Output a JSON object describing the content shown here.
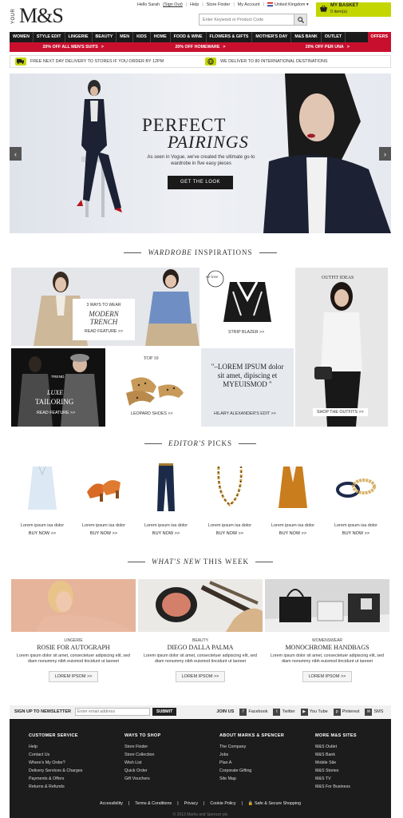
{
  "header": {
    "logo_your": "YOUR",
    "logo_text": "M&S",
    "greeting": "Hello Sarah",
    "sign_out": "(Sign Out)",
    "help": "Help",
    "store_finder": "Store Finder",
    "my_account": "My Account",
    "country": "United Kingdom",
    "search_placeholder": "Enter Keyword or Product Code",
    "basket_title": "MY BASKET",
    "basket_items": "0 item(s)"
  },
  "nav": [
    "WOMEN",
    "STYLE EDIT",
    "LINGERIE",
    "BEAUTY",
    "MEN",
    "KIDS",
    "HOME",
    "FOOD & WINE",
    "FLOWERS & GIFTS",
    "MOTHER'S DAY",
    "M&S BANK",
    "OUTLET",
    "OFFERS"
  ],
  "promos": [
    "20% OFF ALL MEN'S SUITS",
    "20% OFF HOMEWARE",
    "20% OFF PER UNA"
  ],
  "promo_arrow": ">",
  "delivery": {
    "left": "FREE NEXT DAY DELIVERY TO STORES IF YOU ORDER BY 12PM",
    "right": "WE DELIVER TO 80 INTERNATIONAL DESTINATIONS"
  },
  "hero": {
    "title1": "PERFECT",
    "title2": "PAIRINGS",
    "copy": "As seen in Vogue, we've created the ultimate go-to wardrobe in five easy pieces",
    "cta": "GET THE LOOK"
  },
  "wardrobe": {
    "heading_italic": "WARDROBE",
    "heading_rest": " INSPIRATIONS",
    "trench_kicker": "3 WAYS TO WEAR",
    "trench_title": "MODERN TRENCH",
    "trench_link": "READ FEATURE  >>",
    "blazer_badge": "we love",
    "blazer_link": "STRIP BLAZER  >>",
    "outfit_title": "OUTFIT IDEAS",
    "outfit_link": "SHOP THE OUTFITS  >>",
    "tailoring_kicker": "TREND",
    "tailoring_title1": "LUXE",
    "tailoring_title2": "TAILORING",
    "tailoring_link": "READ FEATURE  >>",
    "shoes_kicker": "TOP 10",
    "shoes_link": "LEOPARD SHOES  >>",
    "quote": "\"–LOREM IPSUM dolor sit amet, dipiscing et MYEUISMOD \"",
    "quote_link": "HILARY ALEXANDER'S EDIT  >>"
  },
  "picks": {
    "heading_italic": "EDITOR'S",
    "heading_rest": " PICKS",
    "items": [
      {
        "name": "Lorem ipsum isa dolor",
        "buy": "BUY NOW  >>"
      },
      {
        "name": "Lorem ipsum isa dolor",
        "buy": "BUY NOW  >>"
      },
      {
        "name": "Lorem ipsum isa dolor",
        "buy": "BUY NOW  >>"
      },
      {
        "name": "Lorem ipsum isa dolor",
        "buy": "BUY NOW  >>"
      },
      {
        "name": "Lorem ipsum isa dolor",
        "buy": "BUY NOW  >>"
      },
      {
        "name": "Lorem ipsum isa dolor",
        "buy": "BUY NOW  >>"
      }
    ]
  },
  "whatsnew": {
    "heading_italic": "WHAT'S NEW",
    "heading_rest": " THIS WEEK",
    "items": [
      {
        "cat": "LINGERIE",
        "title": "ROSIE FOR AUTOGRAPH",
        "text": "Lorem ipsum dolor sit amet, consectetuer adipiscing elit, sed diam nonummy nibh euismod tincidunt ut laoreet",
        "btn": "LOREM IPSOM  >>"
      },
      {
        "cat": "BEAUTY",
        "title": "DIEGO DALLA PALMA",
        "text": "Lorem ipsum dolor sit amet, consectetuer adipiscing elit, sed diam nonummy nibh euismod tincidunt ut laoreet",
        "btn": "LOREM IPSOM  >>"
      },
      {
        "cat": "WOMENSWEAR",
        "title": "MONOCHROME HANDBAGS",
        "text": "Lorem ipsum dolor sit amet, consectetuer adipiscing elit, sed diam nonummy nibh euismod tincidunt ut laoreet",
        "btn": "LOREM IPSOM  >>"
      }
    ]
  },
  "newsletter": {
    "label": "SIGN UP TO NEWSLETTER",
    "placeholder": "Enter email address",
    "submit": "SUBMIT",
    "join": "JOIN US",
    "social": [
      {
        "label": "Facebook",
        "icon": "f"
      },
      {
        "label": "Twitter",
        "icon": "t"
      },
      {
        "label": "You Tube",
        "icon": "▶"
      },
      {
        "label": "Pinterest",
        "icon": "p"
      },
      {
        "label": "SMS",
        "icon": "✉"
      }
    ]
  },
  "footer": {
    "cols": [
      {
        "title": "CUSTOMER SERVICE",
        "links": [
          "Help",
          "Contact Us",
          "Where's My Order?",
          "Delivery Services & Charges",
          "Payments & Offers",
          "Returns & Refunds"
        ]
      },
      {
        "title": "WAYS TO SHOP",
        "links": [
          "Store Finder",
          "Store Collection",
          "Wish List",
          "Quick Order",
          "Gift Vouchers"
        ]
      },
      {
        "title": "ABOUT MARKS & SPENCER",
        "links": [
          "The Company",
          "Jobs",
          "Plan A",
          "Corporate Gifting",
          "Site Map"
        ]
      },
      {
        "title": "MORE M&S SITES",
        "links": [
          "M&S Outlet",
          "M&S Bank",
          "Mobile Site",
          "M&S Stories",
          "M&S TV",
          "M&S For Business"
        ]
      }
    ],
    "bottom": [
      "Accessibility",
      "Terms & Conditions",
      "Privacy",
      "Cookie Policy",
      "Safe & Secure Shopping"
    ],
    "copyright": "© 2013 Marks and Spencer plc"
  },
  "colors": {
    "accent": "#c4d600",
    "promo_red": "#c8102e",
    "nav_bg": "#1a1a1a",
    "footer_bg": "#1c1c1c"
  }
}
